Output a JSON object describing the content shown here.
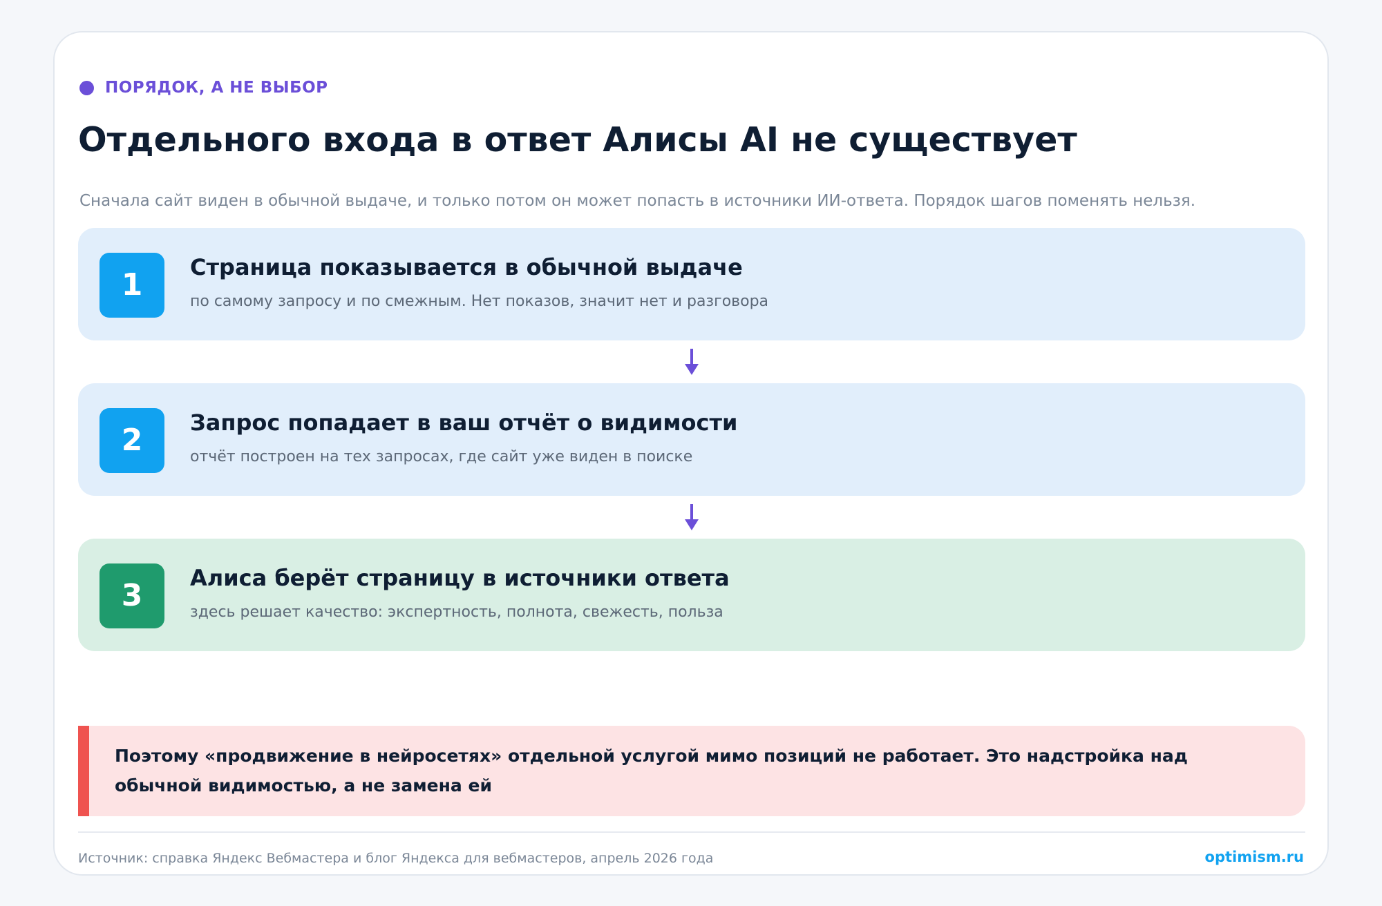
{
  "header": {
    "eyebrow": "ПОРЯДОК, А НЕ ВЫБОР",
    "title": "Отдельного входа в ответ Алисы AI не существует",
    "subtitle": "Сначала сайт виден в обычной выдаче, и только потом он может попасть в источники ИИ-ответа. Порядок шагов поменять нельзя."
  },
  "steps": [
    {
      "number": "1",
      "title": "Страница показывается в обычной выдаче",
      "description": "по самому запросу и по смежным. Нет показов, значит нет и разговора"
    },
    {
      "number": "2",
      "title": "Запрос попадает в ваш отчёт о видимости",
      "description": "отчёт построен на тех запросах, где сайт уже виден в поиске"
    },
    {
      "number": "3",
      "title": "Алиса берёт страницу в источники ответа",
      "description": "здесь решает качество: экспертность, полнота, свежесть, польза"
    }
  ],
  "note": {
    "text": "Поэтому «продвижение в нейросетях» отдельной услугой мимо позиций не работает. Это надстройка над обычной видимостью, а не замена ей"
  },
  "footer": {
    "source": "Источник: справка Яндекс Вебмастера и блог Яндекса для вебмастеров, апрель 2026 года",
    "brand": "optimism.ru"
  },
  "colors": {
    "accent": "#6b4fd8",
    "step_blue_bg": "#e1eefb",
    "step_green_bg": "#d9efe4",
    "number_blue": "#11a2f0",
    "number_green": "#1f9b6d",
    "note_bg": "#fde3e4",
    "note_bar": "#ef5350",
    "brand": "#11a2f0"
  },
  "icons": {
    "eyebrow_marker": "dot-icon",
    "connector": "arrow-down-icon"
  }
}
